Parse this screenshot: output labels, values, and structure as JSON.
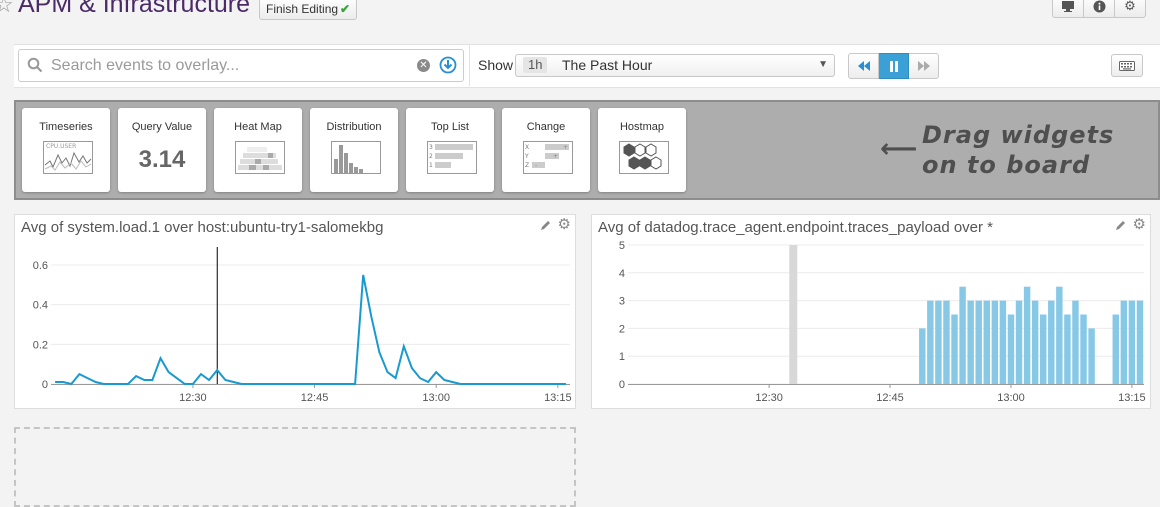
{
  "header": {
    "title": "APM & Infrastructure",
    "finish_editing": "Finish Editing",
    "buttons": [
      "monitor-icon",
      "info-icon",
      "gear-icon"
    ]
  },
  "toolbar": {
    "search_placeholder": "Search events to overlay...",
    "show_label": "Show",
    "time_badge": "1h",
    "time_label": "The Past Hour"
  },
  "widget_tray": {
    "tiles": [
      {
        "label": "Timeseries",
        "icon": "timeseries-icon",
        "sample": "CPU.USER"
      },
      {
        "label": "Query Value",
        "icon": "query-value-icon",
        "value": "3.14"
      },
      {
        "label": "Heat Map",
        "icon": "heatmap-icon"
      },
      {
        "label": "Distribution",
        "icon": "distribution-icon"
      },
      {
        "label": "Top List",
        "icon": "toplist-icon",
        "sample_rows": [
          "3",
          "2",
          "1"
        ]
      },
      {
        "label": "Change",
        "icon": "change-icon",
        "sample_rows": [
          "X",
          "Y",
          "Z"
        ]
      },
      {
        "label": "Hostmap",
        "icon": "hostmap-icon"
      }
    ],
    "drag_hint_line1": "Drag widgets",
    "drag_hint_line2": "on to board"
  },
  "chart_data": [
    {
      "type": "line",
      "title": "Avg of system.load.1 over host:ubuntu-try1-salomekbg",
      "x_ticks": [
        "12:30",
        "12:45",
        "13:00",
        "13:15"
      ],
      "y_ticks": [
        "0",
        "0.2",
        "0.4",
        "0.6"
      ],
      "ylim": [
        0,
        0.6
      ],
      "x_minutes_range": [
        12.5,
        76.5
      ],
      "marker_minutes": 33,
      "color": "#189ad1",
      "series": [
        {
          "x": [
            13,
            14,
            15,
            16,
            17,
            18,
            19,
            20,
            21,
            22,
            23,
            24,
            25,
            26,
            27,
            28,
            29,
            30,
            31,
            32,
            33,
            34,
            35,
            36,
            37,
            38,
            39,
            40,
            41,
            42,
            43,
            44,
            45,
            46,
            47,
            48,
            49,
            50,
            51,
            52,
            53,
            54,
            55,
            56,
            57,
            58,
            59,
            60,
            61,
            62,
            63,
            64,
            65,
            66,
            67,
            68,
            69,
            70,
            71,
            72,
            73,
            74,
            75,
            76
          ],
          "y": [
            0.01,
            0.01,
            0.0,
            0.05,
            0.03,
            0.01,
            0.0,
            0.0,
            0.0,
            0.0,
            0.04,
            0.02,
            0.02,
            0.13,
            0.06,
            0.03,
            0.0,
            0.0,
            0.05,
            0.02,
            0.07,
            0.02,
            0.01,
            0.0,
            0.0,
            0.0,
            0.0,
            0.0,
            0.0,
            0.0,
            0.0,
            0.0,
            0.0,
            0.0,
            0.0,
            0.0,
            0.0,
            0.0,
            0.55,
            0.34,
            0.16,
            0.06,
            0.03,
            0.19,
            0.08,
            0.03,
            0.01,
            0.06,
            0.02,
            0.01,
            0.0,
            0.0,
            0.0,
            0.0,
            0.0,
            0.0,
            0.0,
            0.0,
            0.0,
            0.0,
            0.0,
            0.0,
            0.0,
            0.0
          ]
        }
      ]
    },
    {
      "type": "bar",
      "title": "Avg of datadog.trace_agent.endpoint.traces_payload over *",
      "x_ticks": [
        "12:30",
        "12:45",
        "13:00",
        "13:15"
      ],
      "y_ticks": [
        "0",
        "1",
        "2",
        "3",
        "4",
        "5"
      ],
      "ylim": [
        0,
        5
      ],
      "x_minutes_range": [
        12.5,
        76.5
      ],
      "marker_minutes": 33,
      "color": "#87c8e6",
      "series": [
        {
          "x": [
            49,
            50,
            51,
            52,
            53,
            54,
            55,
            56,
            57,
            58,
            59,
            60,
            61,
            62,
            63,
            64,
            65,
            66,
            67,
            68,
            69,
            70,
            71,
            73,
            74,
            75,
            76
          ],
          "y": [
            2,
            3,
            3,
            3,
            2.5,
            3.5,
            3,
            3,
            3,
            3,
            3,
            2.5,
            3,
            3.5,
            3,
            2.5,
            3,
            3.5,
            2.5,
            3,
            2.5,
            2,
            0,
            2.5,
            3,
            3,
            3
          ]
        }
      ]
    }
  ],
  "colors": {
    "accent": "#3aa0d5",
    "title": "#4b2a68",
    "tray": "#adadad"
  }
}
